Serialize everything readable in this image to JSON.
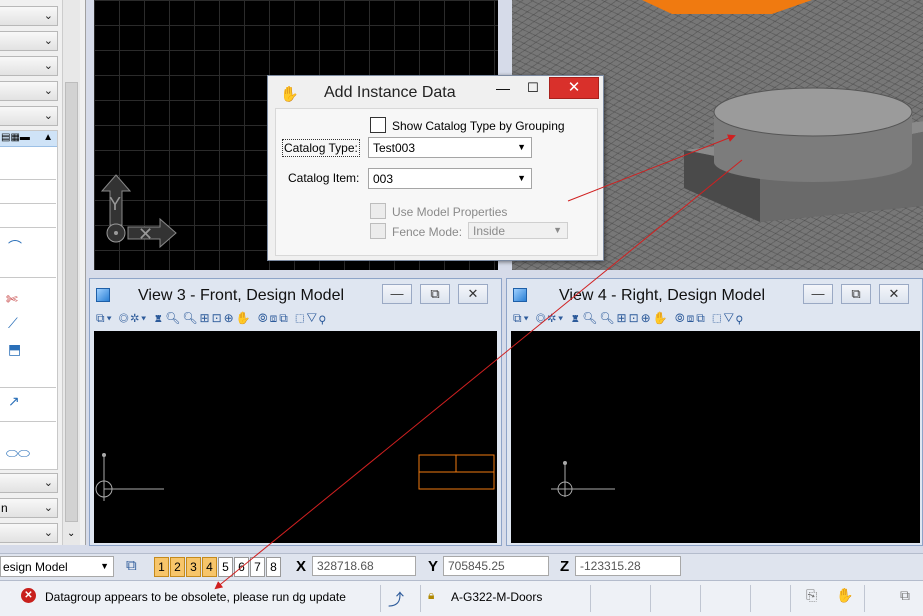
{
  "dialog": {
    "title": "Add Instance Data",
    "show_grouping_label": "Show Catalog Type by Grouping",
    "catalog_type_label": "Catalog Type:",
    "catalog_type_value": "Test003",
    "catalog_item_label": "Catalog Item:",
    "catalog_item_value": "003",
    "use_model_props_label": "Use Model Properties",
    "fence_mode_label": "Fence Mode:",
    "fence_mode_value": "Inside",
    "minimize_glyph": "—",
    "maximize_glyph": "☐",
    "close_glyph": "✕"
  },
  "views": {
    "view3_title": "View 3 - Front, Design Model",
    "view4_title": "View 4 - Right, Design Model",
    "toolbar_glyphs": "⧉▾ ◎✲▾ ♜🔍︎🔍︎⊞⊡⊕✋ ⦾⧈⧉ ⬚▽⚲"
  },
  "left_panel": {
    "bottom_label": "n"
  },
  "statusbar": {
    "model_name": "esign Model",
    "view_buttons": [
      "1",
      "2",
      "3",
      "4",
      "5",
      "6",
      "7",
      "8"
    ],
    "x_label": "X",
    "x_value": "328718.68",
    "y_label": "Y",
    "y_value": "705845.25",
    "z_label": "Z",
    "z_value": "-123315.28",
    "message": "Datagroup appears to be obsolete, please run dg update",
    "level": "A-G322-M-Doors"
  },
  "colors": {
    "accent_orange": "#f7c56a",
    "error_red": "#c8201c",
    "arrow_red": "#d02020"
  }
}
